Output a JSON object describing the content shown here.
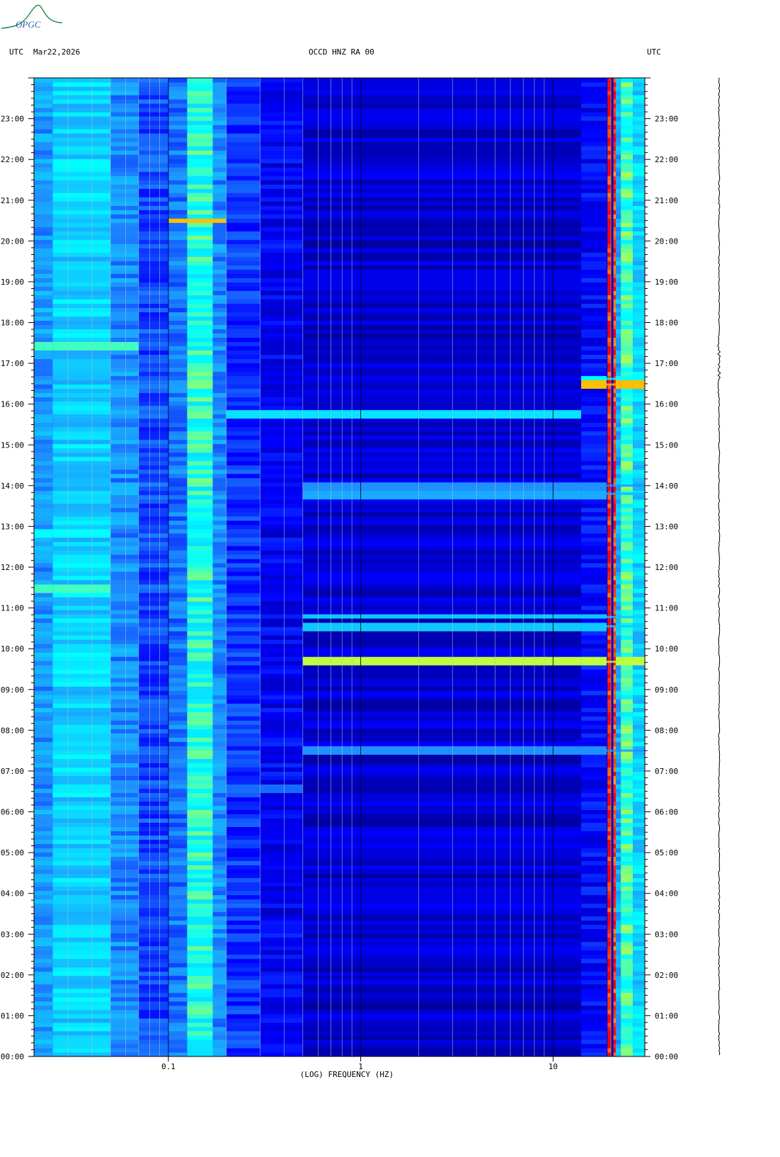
{
  "header": {
    "left_tz": "UTC",
    "date": "Mar22,2026",
    "station": "OCCD HNZ RA 00",
    "right_tz": "UTC"
  },
  "logo": {
    "text": "OPGC",
    "color": "#2e8b57"
  },
  "chart_data": {
    "type": "heatmap",
    "xlabel": "(LOG) FREQUENCY (HZ)",
    "x_scale": "log",
    "xlim": [
      0.02,
      30
    ],
    "x_ticks": [
      {
        "value": 0.1,
        "label": "0.1"
      },
      {
        "value": 1,
        "label": "1"
      },
      {
        "value": 10,
        "label": "10"
      }
    ],
    "y_ticks": [
      "00:00",
      "01:00",
      "02:00",
      "03:00",
      "04:00",
      "05:00",
      "06:00",
      "07:00",
      "08:00",
      "09:00",
      "10:00",
      "11:00",
      "12:00",
      "13:00",
      "14:00",
      "15:00",
      "16:00",
      "17:00",
      "18:00",
      "19:00",
      "20:00",
      "21:00",
      "22:00",
      "23:00"
    ],
    "ylim_hours": [
      0,
      24
    ],
    "colormap": [
      "#00008b",
      "#0000ff",
      "#1e90ff",
      "#00ffff",
      "#ffff00",
      "#ff0000"
    ],
    "background_level": 0.12,
    "bands": [
      {
        "f1": 0.02,
        "f2": 0.025,
        "level": 0.42
      },
      {
        "f1": 0.025,
        "f2": 0.05,
        "level": 0.52
      },
      {
        "f1": 0.05,
        "f2": 0.07,
        "level": 0.4
      },
      {
        "f1": 0.07,
        "f2": 0.1,
        "level": 0.3
      },
      {
        "f1": 0.1,
        "f2": 0.125,
        "level": 0.36
      },
      {
        "f1": 0.125,
        "f2": 0.17,
        "level": 0.62
      },
      {
        "f1": 0.17,
        "f2": 0.2,
        "level": 0.4
      },
      {
        "f1": 0.2,
        "f2": 0.3,
        "level": 0.27
      },
      {
        "f1": 0.3,
        "f2": 0.5,
        "level": 0.18
      },
      {
        "f1": 0.5,
        "f2": 14,
        "level": 0.12
      },
      {
        "f1": 14,
        "f2": 19,
        "level": 0.2
      },
      {
        "f1": 19.2,
        "f2": 20.0,
        "level": 0.98
      },
      {
        "f1": 20.6,
        "f2": 21.2,
        "level": 0.95
      },
      {
        "f1": 21.2,
        "f2": 22.5,
        "level": 0.45
      },
      {
        "f1": 22.5,
        "f2": 26,
        "level": 0.65
      },
      {
        "f1": 26,
        "f2": 30,
        "level": 0.52
      }
    ],
    "events": [
      {
        "hour": 16.48,
        "f1": 14,
        "f2": 30,
        "level": 0.85
      },
      {
        "hour": 16.62,
        "f1": 14,
        "f2": 30,
        "level": 0.6
      },
      {
        "hour": 9.68,
        "f1": 8,
        "f2": 30,
        "level": 0.75
      },
      {
        "hour": 10.55,
        "f1": 8,
        "f2": 30,
        "level": 0.5
      },
      {
        "hour": 10.78,
        "f1": 8,
        "f2": 30,
        "level": 0.5
      },
      {
        "hour": 13.8,
        "f1": 8,
        "f2": 30,
        "level": 0.45
      },
      {
        "hour": 14.0,
        "f1": 8,
        "f2": 30,
        "level": 0.4
      },
      {
        "hour": 15.78,
        "f1": 0.2,
        "f2": 0.8,
        "level": 0.55
      },
      {
        "hour": 20.5,
        "f1": 0.1,
        "f2": 0.2,
        "level": 0.85
      },
      {
        "hour": 17.4,
        "f1": 0.02,
        "f2": 0.07,
        "level": 0.65
      },
      {
        "hour": 11.5,
        "f1": 0.02,
        "f2": 0.05,
        "level": 0.65
      },
      {
        "hour": 12.85,
        "f1": 0.02,
        "f2": 0.05,
        "level": 0.6
      },
      {
        "hour": 7.5,
        "f1": 8,
        "f2": 30,
        "level": 0.4
      },
      {
        "hour": 6.55,
        "f1": 0.2,
        "f2": 0.5,
        "level": 0.35
      }
    ],
    "grid": true
  }
}
